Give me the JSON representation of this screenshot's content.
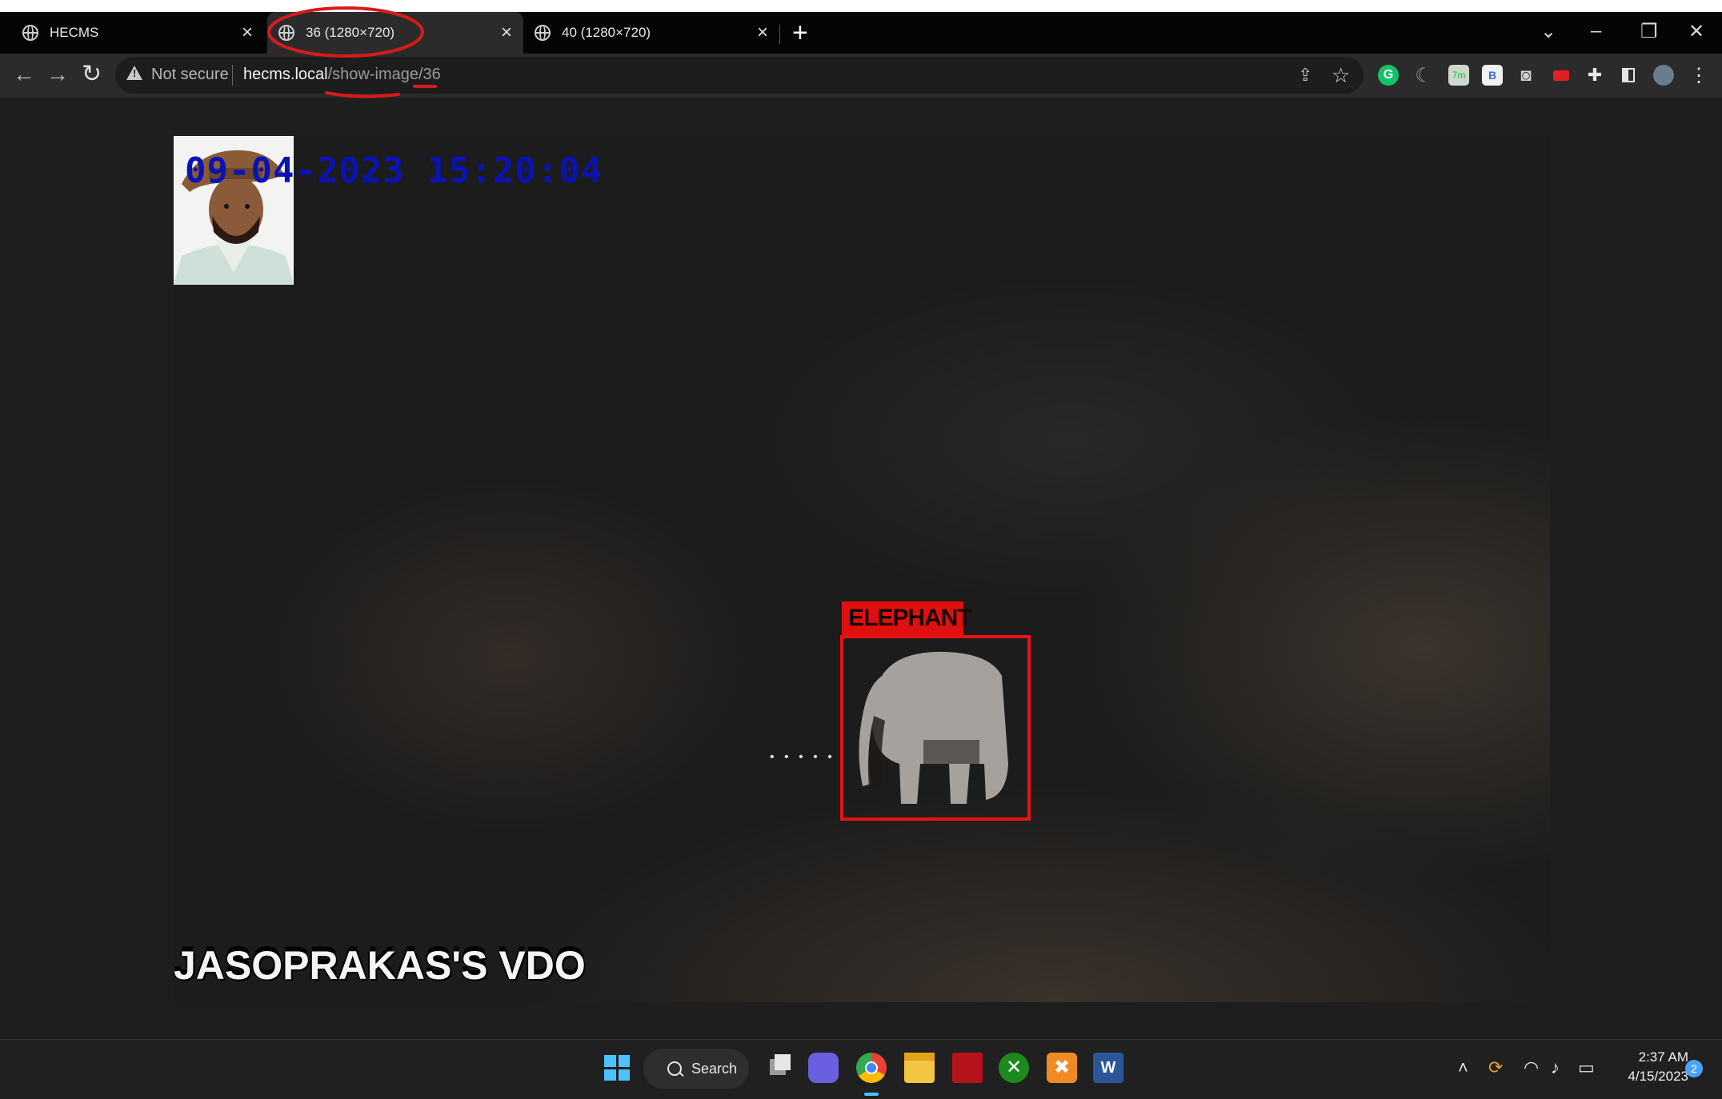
{
  "browser": {
    "tabs": [
      {
        "title": "HECMS",
        "active": false
      },
      {
        "title": "36 (1280×720)",
        "active": true
      },
      {
        "title": "40 (1280×720)",
        "active": false
      }
    ],
    "new_tab_label": "+",
    "security_label": "Not secure",
    "url_host": "hecms.local",
    "url_path": "/show-image/36",
    "window_controls": {
      "minimize": "–",
      "restore": "❐",
      "close": "✕"
    },
    "nav": {
      "back": "←",
      "forward": "→",
      "reload": "↻"
    }
  },
  "frame": {
    "timestamp": "09-04-2023 15:20:04",
    "watermark": "JASOPRAKAS'S VDO",
    "detection_label": "ELEPHANT",
    "detection_color": "#e81212",
    "timestamp_color": "#0b12b5"
  },
  "taskbar": {
    "search_label": "Search",
    "time": "2:37 AM",
    "date": "4/15/2023",
    "notification_count": "2",
    "icons": [
      "windows-start-icon",
      "search-icon",
      "task-view-icon",
      "chat-icon",
      "chrome-icon",
      "file-explorer-icon",
      "app-icon",
      "xbox-icon",
      "xampp-icon",
      "word-icon"
    ]
  },
  "annotations": {
    "color": "#d81a1a"
  }
}
